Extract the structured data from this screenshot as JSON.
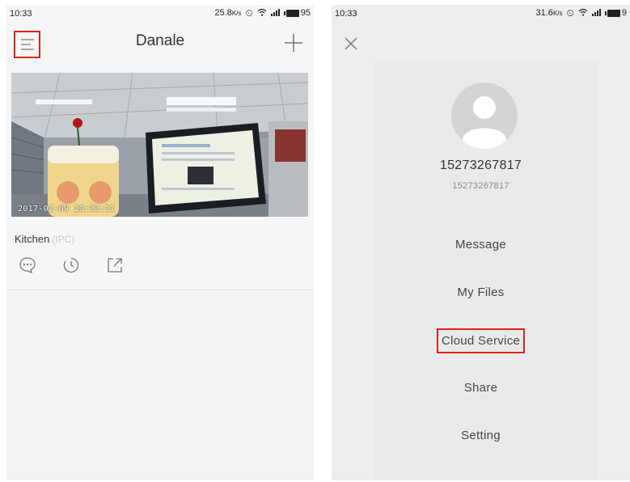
{
  "left": {
    "status": {
      "time": "10:33",
      "speed": "25.8",
      "speed_unit": "K/s",
      "battery": "95"
    },
    "header": {
      "title": "Danale"
    },
    "camera": {
      "timestamp": "2017-02-09 10:33:11",
      "name": "Kitchen",
      "type": "(IPC)"
    }
  },
  "right": {
    "status": {
      "time": "10:33",
      "speed": "31.6",
      "speed_unit": "K/s",
      "battery": "9"
    },
    "user": {
      "name": "15273267817",
      "id": "15273267817"
    },
    "menu": [
      {
        "label": "Message"
      },
      {
        "label": "My Files"
      },
      {
        "label": "Cloud Service",
        "highlighted": true
      },
      {
        "label": "Share"
      },
      {
        "label": "Setting"
      }
    ]
  },
  "colors": {
    "highlight": "#e02020",
    "muted_text": "#c8c8c8"
  },
  "icons": [
    "menu-icon",
    "add-icon",
    "message-icon",
    "playback-clock-icon",
    "share-icon",
    "close-icon",
    "avatar-icon",
    "alarm-clock-icon",
    "wifi-icon",
    "signal-icon",
    "battery-icon"
  ]
}
